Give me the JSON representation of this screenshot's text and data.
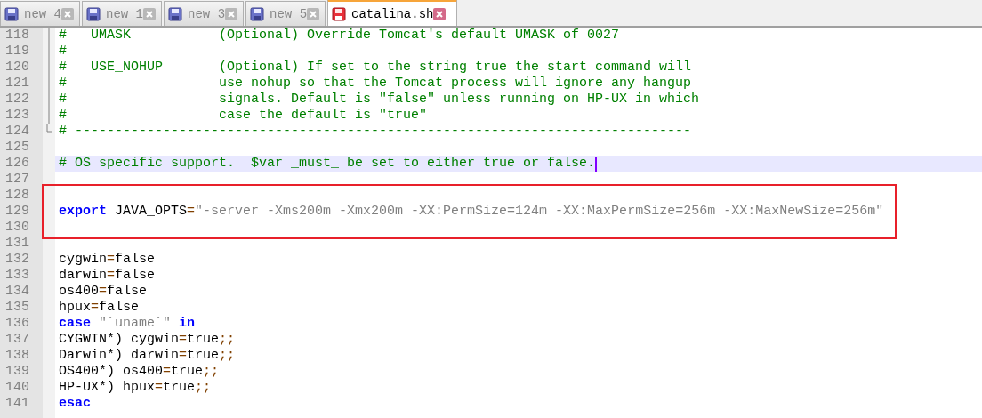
{
  "tabs": [
    {
      "label": "new 4",
      "kind": "saved",
      "selected": false
    },
    {
      "label": "new 1",
      "kind": "saved",
      "selected": false
    },
    {
      "label": "new 3",
      "kind": "saved",
      "selected": false
    },
    {
      "label": "new 5",
      "kind": "saved",
      "selected": false
    },
    {
      "label": "catalina.sh",
      "kind": "modified",
      "selected": true
    }
  ],
  "blocks": [
    {
      "boxed": false,
      "lines": [
        {
          "number": "118",
          "kind": "fold",
          "current": false,
          "tokens": [
            {
              "text": "#   UMASK           (Optional) Override Tomcat's default UMASK of 0027",
              "kind": "comment"
            }
          ]
        },
        {
          "number": "119",
          "kind": "fold",
          "current": false,
          "tokens": [
            {
              "text": "#",
              "kind": "comment"
            }
          ]
        },
        {
          "number": "120",
          "kind": "fold",
          "current": false,
          "tokens": [
            {
              "text": "#   USE_NOHUP       (Optional) If set to the string true the start command will",
              "kind": "comment"
            }
          ]
        },
        {
          "number": "121",
          "kind": "fold",
          "current": false,
          "tokens": [
            {
              "text": "#                   use nohup so that the Tomcat process will ignore any hangup",
              "kind": "comment"
            }
          ]
        },
        {
          "number": "122",
          "kind": "fold",
          "current": false,
          "tokens": [
            {
              "text": "#                   signals. Default is \"false\" unless running on HP-UX in which",
              "kind": "comment"
            }
          ]
        },
        {
          "number": "123",
          "kind": "fold",
          "current": false,
          "tokens": [
            {
              "text": "#                   case the default is \"true\"",
              "kind": "comment"
            }
          ]
        },
        {
          "number": "124",
          "kind": "foldend",
          "current": false,
          "tokens": [
            {
              "text": "# -----------------------------------------------------------------------------",
              "kind": "comment"
            }
          ]
        },
        {
          "number": "125",
          "kind": "plain",
          "current": false
        },
        {
          "number": "126",
          "kind": "plain",
          "current": true,
          "tokens": [
            {
              "text": "# OS specific support.  $var _must_ be set to either true or false.",
              "kind": "comment"
            }
          ]
        },
        {
          "number": "127",
          "kind": "plain",
          "current": false
        }
      ]
    },
    {
      "boxed": true,
      "lines": [
        {
          "number": "128",
          "kind": "plain",
          "current": false
        },
        {
          "number": "129",
          "kind": "plain",
          "current": false,
          "tokens": [
            {
              "text": "export",
              "kind": "keyword"
            },
            {
              "text": " JAVA_OPTS",
              "kind": "plain"
            },
            {
              "text": "=",
              "kind": "operator"
            },
            {
              "text": "\"-server -Xms200m -Xmx200m -XX:PermSize=124m -XX:MaxPermSize=256m -XX:MaxNewSize=256m\"",
              "kind": "string"
            }
          ]
        },
        {
          "number": "130",
          "kind": "plain",
          "current": false
        }
      ]
    },
    {
      "boxed": false,
      "lines": [
        {
          "number": "131",
          "kind": "plain",
          "current": false
        },
        {
          "number": "132",
          "kind": "plain",
          "current": false,
          "tokens": [
            {
              "text": "cygwin",
              "kind": "plain"
            },
            {
              "text": "=",
              "kind": "operator"
            },
            {
              "text": "false",
              "kind": "plain"
            }
          ]
        },
        {
          "number": "133",
          "kind": "plain",
          "current": false,
          "tokens": [
            {
              "text": "darwin",
              "kind": "plain"
            },
            {
              "text": "=",
              "kind": "operator"
            },
            {
              "text": "false",
              "kind": "plain"
            }
          ]
        },
        {
          "number": "134",
          "kind": "plain",
          "current": false,
          "tokens": [
            {
              "text": "os400",
              "kind": "plain"
            },
            {
              "text": "=",
              "kind": "operator"
            },
            {
              "text": "false",
              "kind": "plain"
            }
          ]
        },
        {
          "number": "135",
          "kind": "plain",
          "current": false,
          "tokens": [
            {
              "text": "hpux",
              "kind": "plain"
            },
            {
              "text": "=",
              "kind": "operator"
            },
            {
              "text": "false",
              "kind": "plain"
            }
          ]
        },
        {
          "number": "136",
          "kind": "plain",
          "current": false,
          "tokens": [
            {
              "text": "case",
              "kind": "keyword"
            },
            {
              "text": " \"`uname`\" ",
              "kind": "string"
            },
            {
              "text": "in",
              "kind": "keyword"
            }
          ]
        },
        {
          "number": "137",
          "kind": "plain",
          "current": false,
          "tokens": [
            {
              "text": "CYGWIN*) cygwin",
              "kind": "plain"
            },
            {
              "text": "=",
              "kind": "operator"
            },
            {
              "text": "true",
              "kind": "plain"
            },
            {
              "text": ";;",
              "kind": "operator"
            }
          ]
        },
        {
          "number": "138",
          "kind": "plain",
          "current": false,
          "tokens": [
            {
              "text": "Darwin*) darwin",
              "kind": "plain"
            },
            {
              "text": "=",
              "kind": "operator"
            },
            {
              "text": "true",
              "kind": "plain"
            },
            {
              "text": ";;",
              "kind": "operator"
            }
          ]
        },
        {
          "number": "139",
          "kind": "plain",
          "current": false,
          "tokens": [
            {
              "text": "OS400*) os400",
              "kind": "plain"
            },
            {
              "text": "=",
              "kind": "operator"
            },
            {
              "text": "true",
              "kind": "plain"
            },
            {
              "text": ";;",
              "kind": "operator"
            }
          ]
        },
        {
          "number": "140",
          "kind": "plain",
          "current": false,
          "tokens": [
            {
              "text": "HP-UX*) hpux",
              "kind": "plain"
            },
            {
              "text": "=",
              "kind": "operator"
            },
            {
              "text": "true",
              "kind": "plain"
            },
            {
              "text": ";;",
              "kind": "operator"
            }
          ]
        },
        {
          "number": "141",
          "kind": "plain",
          "current": false,
          "tokens": [
            {
              "text": "esac",
              "kind": "keyword"
            }
          ]
        }
      ]
    }
  ]
}
